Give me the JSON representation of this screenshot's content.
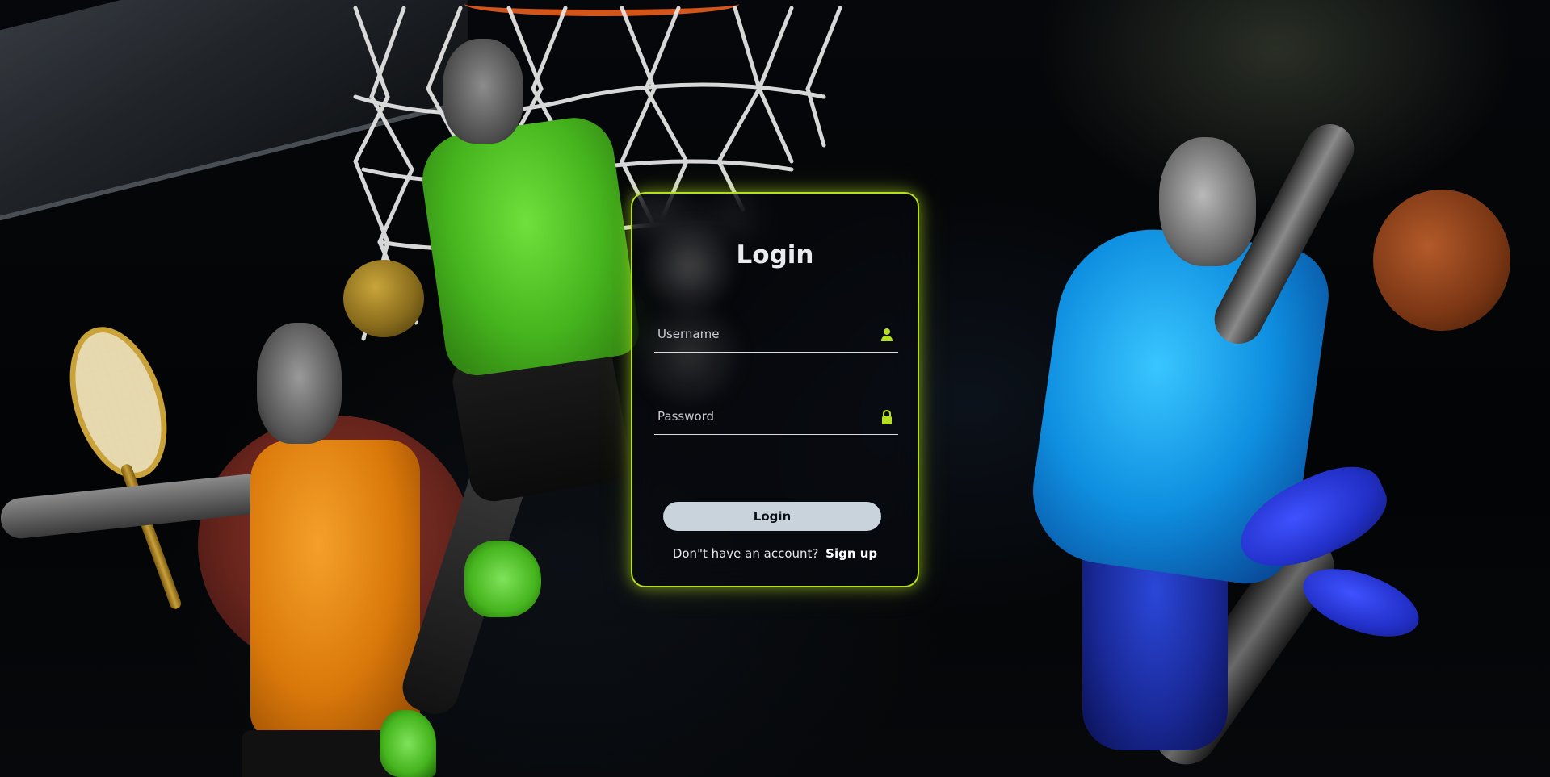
{
  "login": {
    "title": "Login",
    "username_placeholder": "Username",
    "password_placeholder": "Password",
    "button_label": "Login",
    "signup_prompt": "Don\"t have an account?",
    "signup_link": "Sign up"
  },
  "icons": {
    "username": "user-icon",
    "password": "lock-icon"
  },
  "colors": {
    "accent": "#b6de22",
    "button_bg": "#c8d3dc",
    "icon": "#b6de22"
  }
}
